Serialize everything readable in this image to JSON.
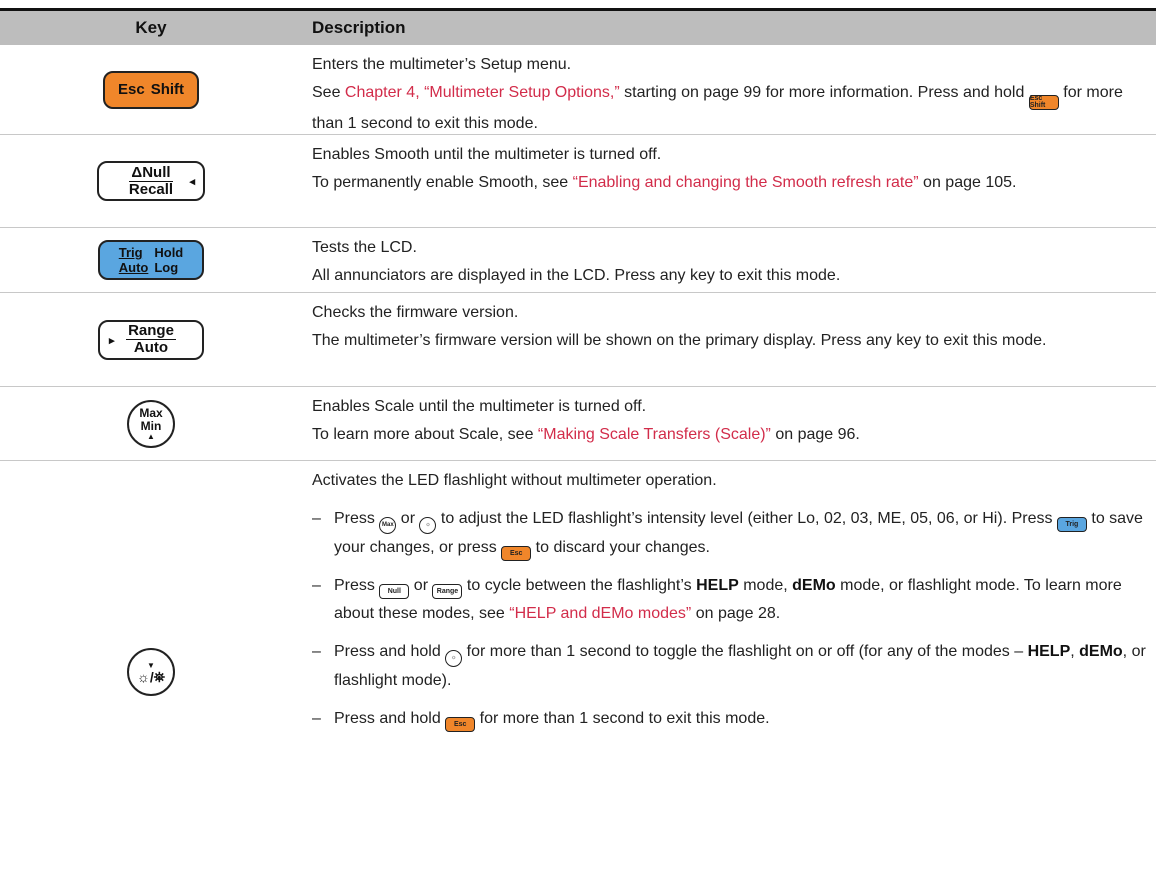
{
  "header": {
    "key": "Key",
    "description": "Description"
  },
  "keys": {
    "esc": {
      "a": "Esc",
      "b": "Shift"
    },
    "null": {
      "top": "ΔNull",
      "bottom": "Recall",
      "arrow": "◂"
    },
    "trig": {
      "tl": "Trig",
      "tr": "Hold",
      "bl": "Auto",
      "br": "Log"
    },
    "range": {
      "top": "Range",
      "bottom": "Auto",
      "arrow": "▸"
    },
    "max": {
      "top": "Max",
      "bottom": "Min",
      "arrow": "▲"
    },
    "flash": {
      "arrow": "▼",
      "symbol": "☼/⛯"
    },
    "colors": {
      "esc": "#f0862a",
      "trig": "#5aa6e0",
      "link": "#d22c4a",
      "header": "#bdbdbd"
    }
  },
  "rows": [
    {
      "line1": "Enters the multimeter’s Setup menu.",
      "l2a": "See ",
      "l2link": "Chapter 4, “Multimeter Setup Options,”",
      "l2b": " starting on page 99 for more information. Press and hold ",
      "l2c": " for more than 1 second to exit this mode."
    },
    {
      "line1": "Enables Smooth until the multimeter is turned off.",
      "l2a": "To permanently enable Smooth, see ",
      "l2link": "“Enabling and changing the Smooth refresh rate”",
      "l2b": " on page 105."
    },
    {
      "line1": "Tests the LCD.",
      "line2": "All annunciators are displayed in the LCD. Press any key to exit this mode."
    },
    {
      "line1": "Checks the firmware version.",
      "line2": "The multimeter’s firmware version will be shown on the primary display. Press any key to exit this mode."
    },
    {
      "line1": "Enables Scale until the multimeter is turned off.",
      "l2a": "To learn more about Scale, see ",
      "l2link": "“Making Scale Transfers (Scale)”",
      "l2b": " on page 96."
    },
    {
      "line1": "Activates the LED flashlight without multimeter operation.",
      "b1a": "Press ",
      "b1b": " or ",
      "b1c": " to adjust the LED flashlight’s intensity level (either Lo, 02, 03, ME, 05, 06, or Hi). Press ",
      "b1d": " to save your changes, or press ",
      "b1e": " to discard your changes.",
      "b2a": "Press ",
      "b2b": " or ",
      "b2c": " to cycle between the flashlight’s ",
      "b2help": "HELP",
      "b2d": " mode, ",
      "b2demo": "dEMo",
      "b2e": " mode, or flashlight mode. To learn more about these modes, see ",
      "b2link": "“HELP and dEMo modes”",
      "b2f": " on page 28.",
      "b3a": "Press and hold ",
      "b3b": " for more than 1 second to toggle the flashlight on or off (for any of the modes – ",
      "b3help": "HELP",
      "b3c": ", ",
      "b3demo": "dEMo",
      "b3d": ", or flashlight mode).",
      "b4a": "Press and hold ",
      "b4b": " for more than 1 second to exit this mode."
    }
  ]
}
